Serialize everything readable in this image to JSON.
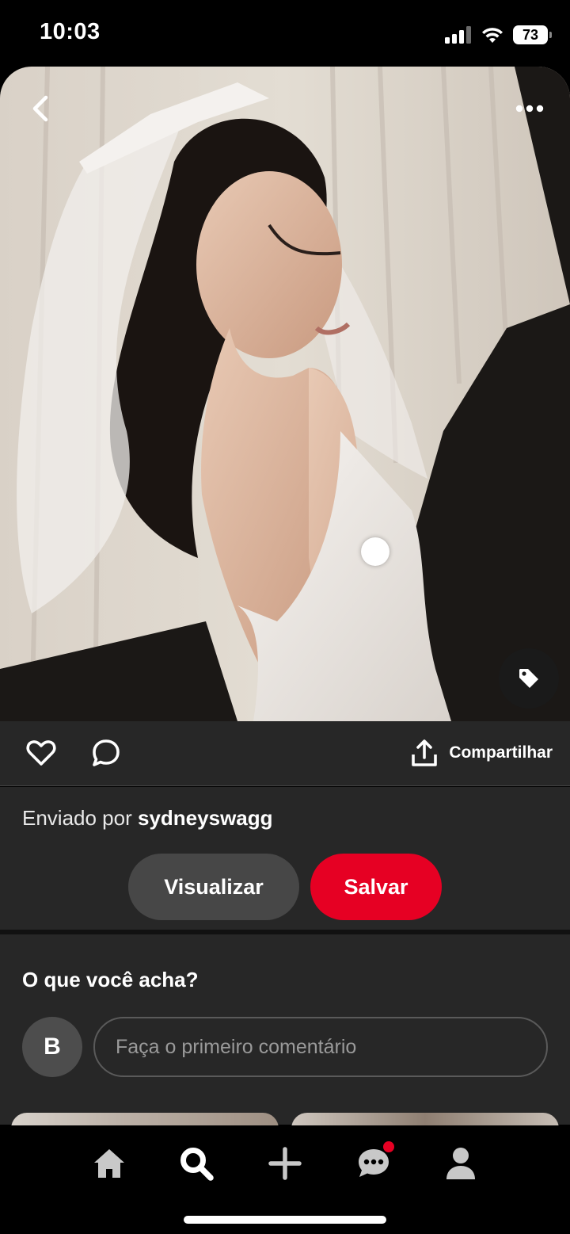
{
  "status_bar": {
    "time": "10:03",
    "battery": "73"
  },
  "pin": {
    "image_subject": "Bride in white strapless satin dress with bow veil, looking over shoulder",
    "colors": {
      "background_top": "#ddd6cc",
      "background_dark": "#1b1816"
    }
  },
  "actions": {
    "share_label": "Compartilhar"
  },
  "info": {
    "sent_by_prefix": "Enviado por",
    "username": "sydneyswagg"
  },
  "buttons": {
    "view_label": "Visualizar",
    "save_label": "Salvar",
    "save_color": "#e60023"
  },
  "comments": {
    "title": "O que você acha?",
    "avatar_initial": "B",
    "input_placeholder": "Faça o primeiro comentário"
  },
  "nav": {
    "items": [
      "home-icon",
      "search-icon",
      "plus-icon",
      "messages-icon",
      "profile-icon"
    ],
    "active": "search"
  }
}
